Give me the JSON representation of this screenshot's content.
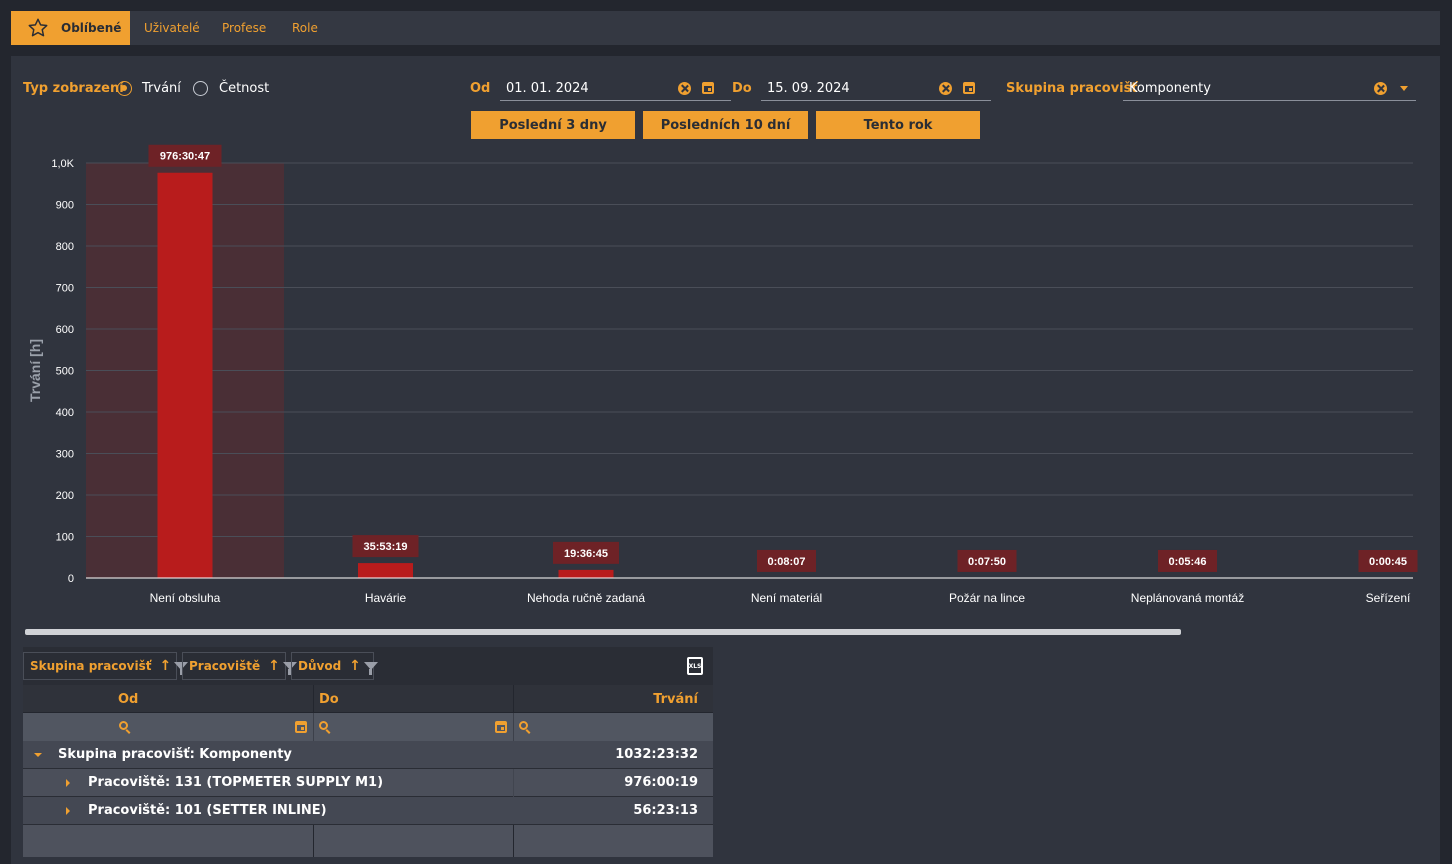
{
  "tabs": [
    {
      "label": "Oblíbené",
      "active": true,
      "icon": "star-icon"
    },
    {
      "label": "Uživatelé",
      "active": false
    },
    {
      "label": "Profese",
      "active": false
    },
    {
      "label": "Role",
      "active": false
    }
  ],
  "filters": {
    "display_type_label": "Typ zobrazení",
    "radio_duration": "Trvání",
    "radio_frequency": "Četnost",
    "selected": "Trvání",
    "from_label": "Od",
    "from_value": "01. 01. 2024",
    "to_label": "Do",
    "to_value": "15. 09. 2024",
    "group_label": "Skupina pracovišť",
    "group_value": "Komponenty"
  },
  "quick_buttons": [
    "Poslední 3 dny",
    "Posledních 10 dní",
    "Tento rok"
  ],
  "chart_data": {
    "type": "bar",
    "ylabel": "Trvání [h]",
    "ylim": [
      0,
      1000
    ],
    "yticks": [
      "0",
      "100",
      "200",
      "300",
      "400",
      "500",
      "600",
      "700",
      "800",
      "900",
      "1,0K"
    ],
    "categories": [
      "Není obsluha",
      "Havárie",
      "Nehoda ručně zadaná",
      "Není materiál",
      "Požár na lince",
      "Neplánovaná montáž",
      "Seřízení"
    ],
    "values": [
      976.51,
      35.89,
      19.61,
      0.14,
      0.13,
      0.1,
      0.01
    ],
    "data_labels": [
      "976:30:47",
      "35:53:19",
      "19:36:45",
      "0:08:07",
      "0:07:50",
      "0:05:46",
      "0:00:45"
    ],
    "highlighted_index": 0,
    "bar_color": "#b81c1c",
    "label_bg": "#6e2226"
  },
  "grid": {
    "group_chips": [
      "Skupina pracovišť",
      "Pracoviště",
      "Důvod"
    ],
    "columns": [
      "Od",
      "Do",
      "Trvání"
    ],
    "rows": [
      {
        "label": "Skupina pracovišť: Komponenty",
        "value": "1032:23:32",
        "level": 0,
        "expanded": true
      },
      {
        "label": "Pracoviště: 131 (TOPMETER SUPPLY M1)",
        "value": "976:00:19",
        "level": 1,
        "expanded": false
      },
      {
        "label": "Pracoviště: 101 (SETTER INLINE)",
        "value": "56:23:13",
        "level": 1,
        "expanded": false
      }
    ]
  },
  "colors": {
    "accent": "#f0a030",
    "background": "#23262e",
    "panel": "#30343e"
  }
}
